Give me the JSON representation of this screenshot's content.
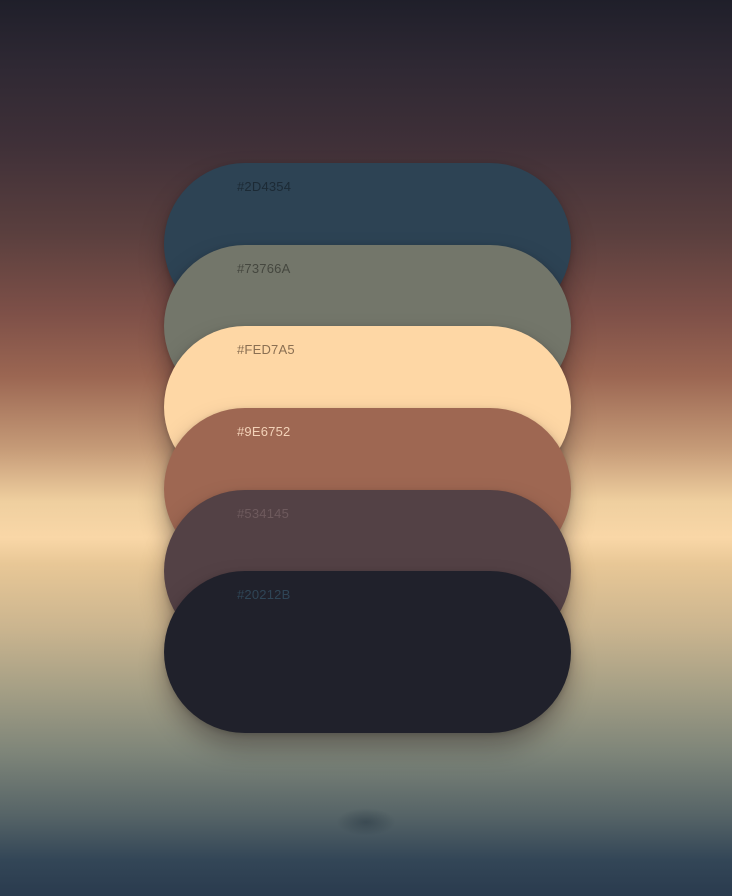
{
  "palette": {
    "swatches": [
      {
        "hex": "#2D4354",
        "label": "#2D4354",
        "label_color": "#1c2a35"
      },
      {
        "hex": "#73766A",
        "label": "#73766A",
        "label_color": "#45473f"
      },
      {
        "hex": "#FED7A5",
        "label": "#FED7A5",
        "label_color": "#8a6f52"
      },
      {
        "hex": "#9E6752",
        "label": "#9E6752",
        "label_color": "#f3d2b8"
      },
      {
        "hex": "#534145",
        "label": "#534145",
        "label_color": "#6e5a5d"
      },
      {
        "hex": "#20212B",
        "label": "#20212B",
        "label_color": "#2f4556"
      }
    ]
  }
}
